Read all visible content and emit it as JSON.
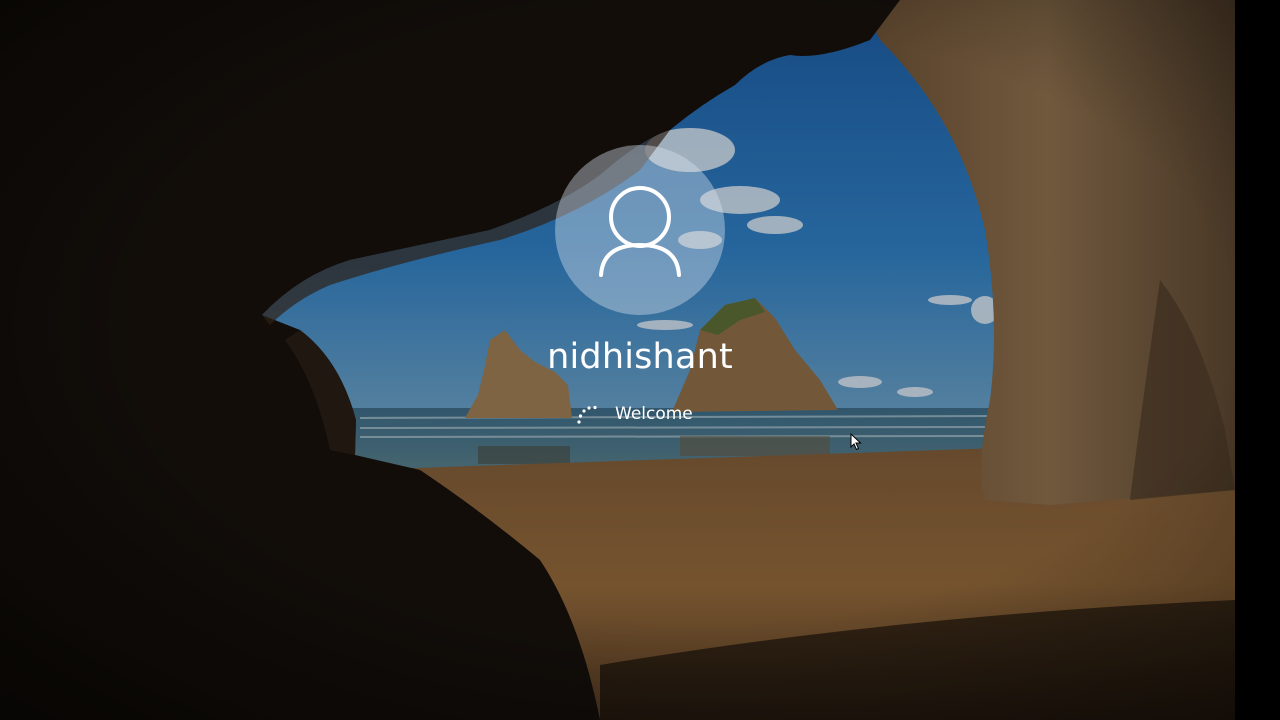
{
  "lock_screen": {
    "username": "nidhishant",
    "status_text": "Welcome"
  },
  "icons": {
    "avatar": "user-account-icon",
    "spinner": "loading-spinner-icon",
    "cursor": "mouse-pointer-icon"
  },
  "colors": {
    "text": "#ffffff",
    "avatar_circle": "rgba(215,225,235,0.42)",
    "sky": "#2a6fb0",
    "sand": "#8a6236",
    "rock": "#1a120c"
  }
}
